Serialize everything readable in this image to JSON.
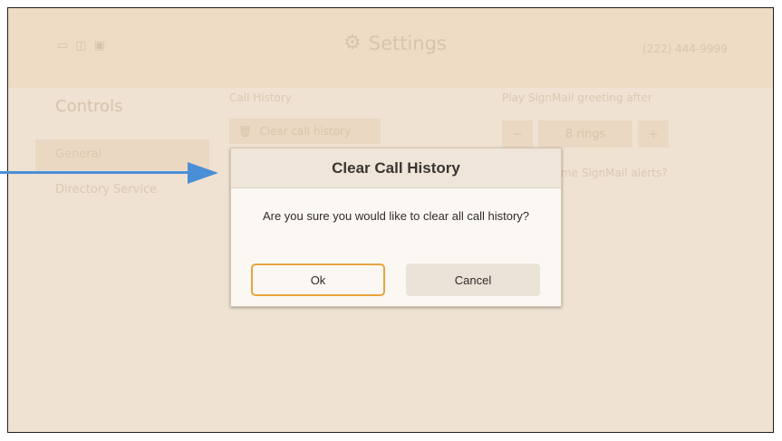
{
  "header": {
    "title": "Settings",
    "phone_number": "(222) 444-9999",
    "status_icons": [
      "screen-icon",
      "signal-icon",
      "device-icon"
    ]
  },
  "sidebar": {
    "title": "Controls",
    "items": [
      {
        "label": "General",
        "selected": true
      },
      {
        "label": "Directory Service",
        "selected": false
      }
    ]
  },
  "call_history": {
    "label": "Call History",
    "clear_button_label": "Clear call history"
  },
  "signmail": {
    "greeting_label": "Play SignMail greeting after",
    "rings_value": "8 rings",
    "minus_label": "−",
    "plus_label": "+",
    "alerts_label": "me SignMail alerts?"
  },
  "dialog": {
    "title": "Clear Call History",
    "message": "Are you sure you would like to clear all call history?",
    "ok_label": "Ok",
    "cancel_label": "Cancel"
  },
  "colors": {
    "annotation_arrow": "#4a8fd6",
    "focus_outline": "#e8a33c",
    "screen_background": "#efe2d2"
  }
}
